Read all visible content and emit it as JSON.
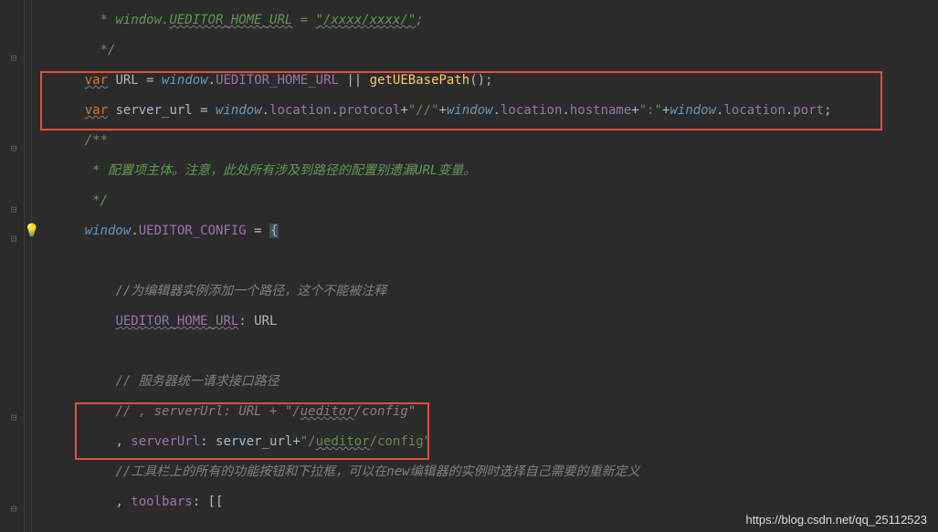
{
  "watermark": "https://blog.csdn.net/qq_25112523",
  "lines": {
    "l1": {
      "star": "* ",
      "win": "window",
      "dot": ".",
      "u": "UEDITOR_HOME_URL",
      "eq": " = ",
      "str": "\"/xxxx/xxxx/\"",
      "semi": ";"
    },
    "l2": {
      "text": "*/"
    },
    "l3": {
      "var": "var",
      "sp": " ",
      "url": "URL",
      "eq": " = ",
      "win": "window",
      "dot": ".",
      "prop": "UEDITOR_HOME_URL",
      "or": " || ",
      "fn": "getUEBasePath",
      "paren": "();"
    },
    "l4": {
      "var": "var",
      "sp": " ",
      "name": "server_url",
      "eq": " = ",
      "win": "window",
      "d1": ".",
      "loc": "location",
      "d2": ".",
      "proto": "protocol",
      "plus1": "+",
      "s1": "\"//\"",
      "plus2": "+",
      "win2": "window",
      "d3": ".",
      "loc2": "location",
      "d4": ".",
      "host": "hostname",
      "plus3": "+",
      "s2": "\":\"",
      "plus4": "+",
      "win3": "window",
      "d5": ".",
      "loc3": "location",
      "d6": ".",
      "port": "port",
      "semi": ";"
    },
    "l5": {
      "text": "/**"
    },
    "l6": {
      "star": "* ",
      "text": "配置项主体。注意，此处所有涉及到路径的配置别遗漏URL变量。"
    },
    "l7": {
      "text": "*/"
    },
    "l8": {
      "win": "window",
      "dot": ".",
      "cfg": "UEDITOR_CONFIG",
      "eq": " = ",
      "brace": "{"
    },
    "l9": {
      "text": "//为编辑器实例添加一个路径，这个不能被注释"
    },
    "l10": {
      "key": "UEDITOR_HOME_URL",
      "colon": ": ",
      "val": "URL"
    },
    "l11": {
      "text": "// 服务器统一请求接口路径"
    },
    "l12": {
      "pre": "// , ",
      "key": "serverUrl",
      "colon": ": ",
      "val": "URL + \"/",
      "ued": "ueditor",
      "suf": "/config\""
    },
    "l13": {
      "comma": ", ",
      "key": "serverUrl",
      "colon": ": ",
      "val": "server_url",
      "plus": "+",
      "q": "\"/",
      "ued": "ueditor",
      "suf": "/config\""
    },
    "l14": {
      "text": "//工具栏上的所有的功能按钮和下拉框，可以在new编辑器的实例时选择自己需要的重新定义"
    },
    "l15": {
      "comma": ", ",
      "key": "toolbars",
      "colon": ": ",
      "br": "[["
    }
  }
}
